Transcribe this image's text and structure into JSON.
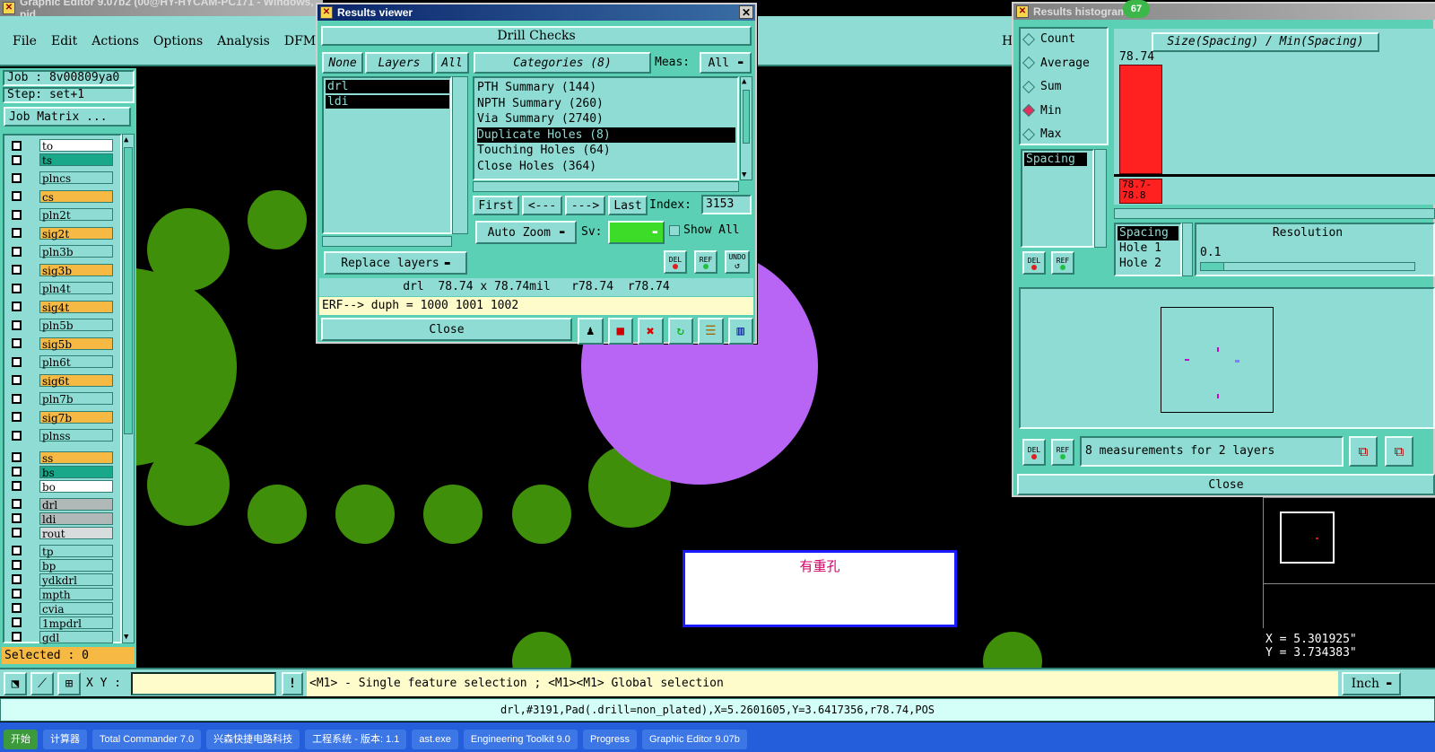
{
  "main_window": {
    "title": "Graphic Editor 9.07b2 (00@HY-HYCAM-PC171 - Windows, pid",
    "menu": [
      "File",
      "Edit",
      "Actions",
      "Options",
      "Analysis",
      "DFM",
      "St"
    ],
    "menu_right_letter": "H",
    "job_label": "Job : 8v00809ya0",
    "step_label": "Step: set+1",
    "job_matrix_button": "Job Matrix ...",
    "layers": [
      {
        "name": "to",
        "color": "#ffffff"
      },
      {
        "name": "ts",
        "color": "#1aa88a"
      },
      {
        "name": "plncs",
        "color": "#8fdcd4"
      },
      {
        "name": "cs",
        "color": "#f5b944"
      },
      {
        "name": "pln2t",
        "color": "#8fdcd4"
      },
      {
        "name": "sig2t",
        "color": "#f5b944"
      },
      {
        "name": "pln3b",
        "color": "#8fdcd4"
      },
      {
        "name": "sig3b",
        "color": "#f5b944"
      },
      {
        "name": "pln4t",
        "color": "#8fdcd4"
      },
      {
        "name": "sig4t",
        "color": "#f5b944"
      },
      {
        "name": "pln5b",
        "color": "#8fdcd4"
      },
      {
        "name": "sig5b",
        "color": "#f5b944"
      },
      {
        "name": "pln6t",
        "color": "#8fdcd4"
      },
      {
        "name": "sig6t",
        "color": "#f5b944"
      },
      {
        "name": "pln7b",
        "color": "#8fdcd4"
      },
      {
        "name": "sig7b",
        "color": "#f5b944"
      },
      {
        "name": "plnss",
        "color": "#8fdcd4"
      },
      {
        "name": "ss",
        "color": "#f5b944"
      },
      {
        "name": "bs",
        "color": "#1aa88a"
      },
      {
        "name": "bo",
        "color": "#ffffff"
      },
      {
        "name": "drl",
        "color": "#b0b8b8"
      },
      {
        "name": "ldi",
        "color": "#b0b8b8"
      },
      {
        "name": "rout",
        "color": "#d8dcdc"
      },
      {
        "name": "tp",
        "color": "#8fdcd4"
      },
      {
        "name": "bp",
        "color": "#8fdcd4"
      },
      {
        "name": "ydkdrl",
        "color": "#8fdcd4"
      },
      {
        "name": "mpth",
        "color": "#8fdcd4"
      },
      {
        "name": "cvia",
        "color": "#8fdcd4"
      },
      {
        "name": "1mpdrl",
        "color": "#8fdcd4"
      },
      {
        "name": "gdl",
        "color": "#8fdcd4"
      }
    ],
    "selected_label": "Selected : 0",
    "canvas_annotation": "有重孔",
    "xy_label": "X Y :",
    "xy_input_value": "",
    "hint_text": "<M1> - Single feature selection ; <M1><M1> Global selection",
    "units_button": "Inch",
    "coord_x": "X = 5.301925\"",
    "coord_y": "Y = 3.734383\"",
    "status_line": "drl,#3191,Pad(.drill=non_plated),X=5.2601605,Y=3.6417356,r78.74,POS"
  },
  "results_viewer": {
    "title": "Results viewer",
    "header": "Drill Checks",
    "none_button": "None",
    "layers_label": "Layers",
    "all_button": "All",
    "layer_list": [
      "drl",
      "ldi"
    ],
    "categories_label": "Categories (8)",
    "meas_label": "Meas:",
    "meas_value": "All",
    "categories": [
      "PTH Summary (144)",
      "NPTH Summary (260)",
      "Via Summary (2740)",
      "Duplicate Holes (8)",
      "Touching Holes (64)",
      "Close Holes (364)"
    ],
    "selected_category": "Duplicate Holes (8)",
    "first_button": "First",
    "prev_button": "<---",
    "next_button": "--->",
    "last_button": "Last",
    "index_label": "Index:",
    "index_value": "3153",
    "auto_zoom": "Auto Zoom",
    "sv_label": "Sv:",
    "show_all": "Show All",
    "replace_layers": "Replace layers",
    "del_label": "DEL",
    "ref_label": "REF",
    "undo_label": "UNDO",
    "info_line": "drl  78.74 x 78.74mil   r78.74  r78.74",
    "erf_line": "ERF--> duph = 1000 1001 1002",
    "close_button": "Close"
  },
  "histogram": {
    "title": "Results histogram",
    "badge": "67",
    "options": [
      "Count",
      "Average",
      "Sum",
      "Min",
      "Max"
    ],
    "selected_option": "Min",
    "chart_title": "Size(Spacing) / Min(Spacing)",
    "bar_value_label": "78.74",
    "bar_value": 78.74,
    "bar_bin_label": "78.7-\n78.8",
    "measure_list": [
      "Spacing"
    ],
    "spacing_list": [
      "Spacing",
      "Hole 1",
      "Hole 2"
    ],
    "resolution_label": "Resolution",
    "resolution_value": "0.1",
    "measurements_text": "8 measurements for 2 layers",
    "del_label": "DEL",
    "ref_label": "REF",
    "close_button": "Close"
  },
  "taskbar": {
    "items": [
      "开始",
      "计算器",
      "Total Commander 7.0",
      "兴森快捷电路科技",
      "工程系统 - 版本: 1.1",
      "ast.exe",
      "Engineering Toolkit 9.0",
      "Progress",
      "Graphic Editor 9.07b"
    ]
  },
  "colors": {
    "panel": "#5bd0b5",
    "light": "#8fdcd4",
    "pad_green": "#3f8f0a",
    "highlight_purple": "#b865f5",
    "hist_bar": "#ff2020"
  }
}
